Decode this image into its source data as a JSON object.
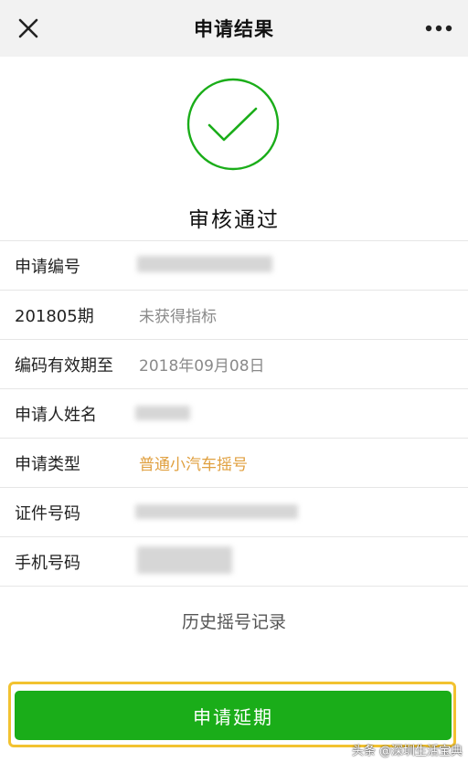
{
  "navbar": {
    "close_icon": "close-icon",
    "title": "申请结果",
    "more_icon": "more-icon"
  },
  "result": {
    "icon": "check-circle-icon",
    "status": "审核通过",
    "accent": "#1aad19"
  },
  "info_rows": [
    {
      "label": "申请编号",
      "value": ""
    },
    {
      "label": "201805期",
      "value": "未获得指标"
    },
    {
      "label": "编码有效期至",
      "value": "2018年09月08日"
    },
    {
      "label": "申请人姓名",
      "value": ""
    },
    {
      "label": "申请类型",
      "value": "普通小汽车摇号",
      "value_color": "#e0a040"
    },
    {
      "label": "证件号码",
      "value": ""
    },
    {
      "label": "手机号码",
      "value": ""
    }
  ],
  "history_link": "历史摇号记录",
  "apply_button": "申请延期",
  "watermark": "头条 @深圳生活宝典"
}
